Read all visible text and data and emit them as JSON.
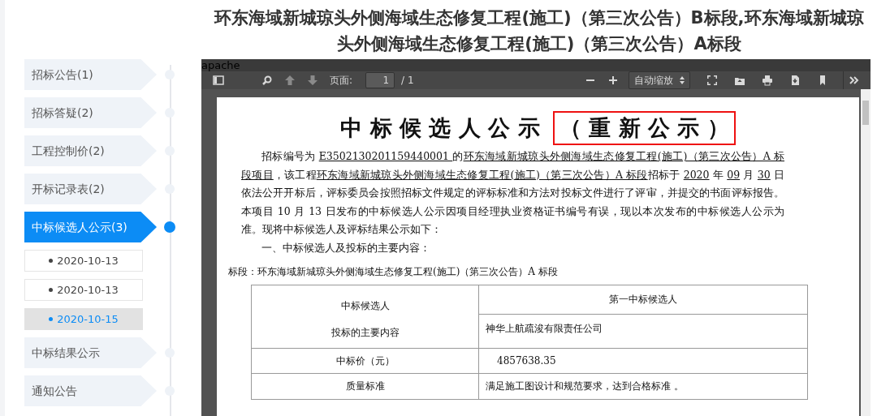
{
  "page_title": "环东海域新城琼头外侧海域生态修复工程(施工)（第三次公告）B标段,环东海域新城琼头外侧海域生态修复工程(施工)（第三次公告）A标段",
  "sidebar": {
    "items": [
      {
        "label": "招标公告(1)",
        "selected": false
      },
      {
        "label": "招标答疑(2)",
        "selected": false
      },
      {
        "label": "工程控制价(2)",
        "selected": false
      },
      {
        "label": "开标记录表(2)",
        "selected": false
      },
      {
        "label": "中标候选人公示(3)",
        "selected": true,
        "children": [
          {
            "label": "2020-10-13",
            "selected": false
          },
          {
            "label": "2020-10-13",
            "selected": false
          },
          {
            "label": "2020-10-15",
            "selected": true
          }
        ]
      },
      {
        "label": "中标结果公示",
        "selected": false
      },
      {
        "label": "通知公告",
        "selected": false
      }
    ]
  },
  "viewer": {
    "frame_label": "apache",
    "toolbar": {
      "page_label": "页面:",
      "page_value": "1",
      "page_total": "/ 1",
      "zoom_select": "自动缩放"
    },
    "document": {
      "title": "中 标 候 选 人 公 示",
      "title_highlight": "（ 重 新 公 示 ）",
      "paragraph": [
        {
          "text": "招标编号为 ",
          "underline": false
        },
        {
          "text": "E3502130201159440001 ",
          "underline": true
        },
        {
          "text": " 的",
          "underline": false
        },
        {
          "text": "环东海域新城琼头外侧海域生态修复工程(施工)（第三次公告）A 标段项目",
          "underline": true
        },
        {
          "text": "，该工程",
          "underline": false
        },
        {
          "text": "环东海域新城琼头外侧海域生态修复工程(施工)（第三次公告）A 标段",
          "underline": true
        },
        {
          "text": "招标于 ",
          "underline": false
        },
        {
          "text": "2020",
          "underline": true
        },
        {
          "text": " 年 ",
          "underline": false
        },
        {
          "text": "09",
          "underline": true
        },
        {
          "text": " 月 ",
          "underline": false
        },
        {
          "text": "30",
          "underline": true
        },
        {
          "text": " 日依法公开开标后，评标委员会按照招标文件规定的评标标准和方法对投标文件进行了评审，并提交的书面评标报告。本项目 10 月 13 日发布的中标候选人公示因项目经理执业资格证书编号有误，现以本次发布的中标候选人公示为准。现将中标候选人及评标结果公示如下：",
          "underline": false
        }
      ],
      "section_heading": "一、中标候选人及投标的主要内容：",
      "lot_line": "标段：环东海域新城琼头外侧海域生态修复工程(施工)（第三次公告）A 标段",
      "table": {
        "header_left_top": "中标候选人",
        "header_left_bottom": "投标的主要内容",
        "header_right": "第一中标候选人",
        "company": "神华上航疏浚有限责任公司",
        "rows": [
          {
            "label": "中标价（元）",
            "value": "4857638.35"
          },
          {
            "label": "质量标准",
            "value": "满足施工图设计和规范要求，达到合格标准 。"
          }
        ]
      }
    }
  }
}
